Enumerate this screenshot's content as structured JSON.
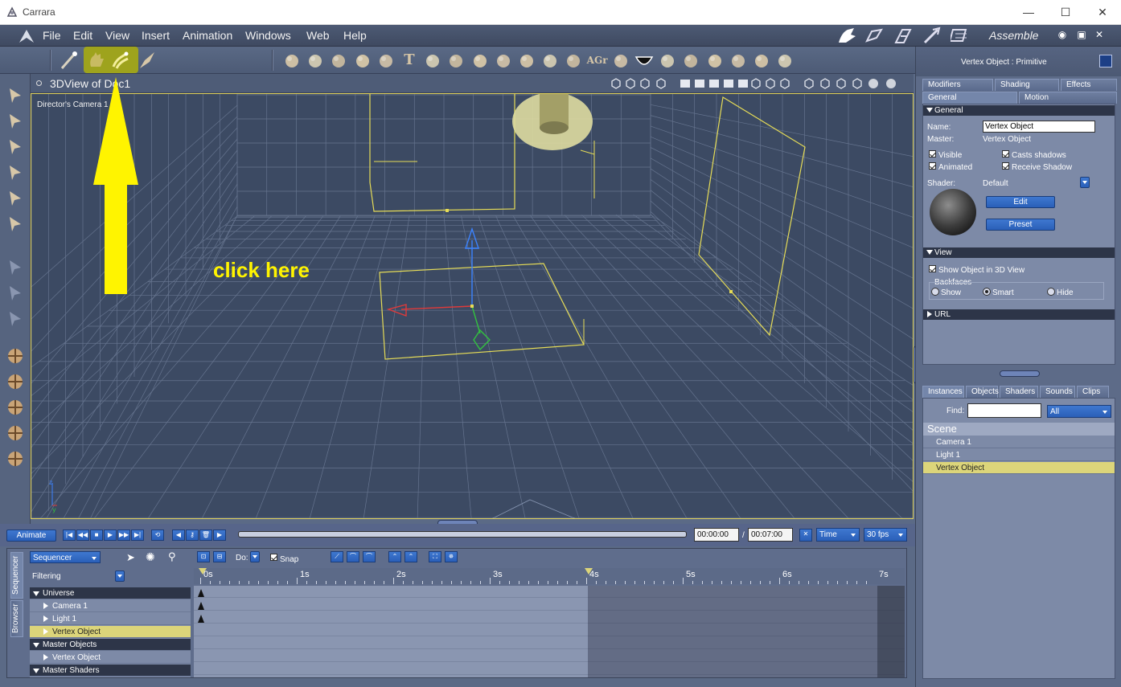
{
  "window": {
    "title": "Carrara",
    "minimize": "—",
    "maximize": "☐",
    "close": "✕"
  },
  "menu": [
    "File",
    "Edit",
    "View",
    "Insert",
    "Animation",
    "Windows",
    "Web",
    "Help"
  ],
  "room": {
    "label": "Assemble"
  },
  "viewport": {
    "title": "3DView of Doc1",
    "camera": "Director's Camera 1",
    "annotation": "click here"
  },
  "colors": {
    "annotation": "#fff400",
    "highlight": "#9ea31d",
    "selected_row": "#dcd57a",
    "grid": "#8997b3",
    "wire": "#e6dc57"
  },
  "right_panel": {
    "title": "Vertex Object : Primitive",
    "tabs_top": [
      "Modifiers",
      "Shading",
      "Effects"
    ],
    "tabs_sub": [
      "General",
      "Motion"
    ],
    "general": {
      "header": "General",
      "name_label": "Name:",
      "name_value": "Vertex Object",
      "master_label": "Master:",
      "master_value": "Vertex Object",
      "visible": "Visible",
      "casts_shadows": "Casts shadows",
      "animated": "Animated",
      "receive_shadow": "Receive Shadow",
      "shader_label": "Shader:",
      "shader_value": "Default",
      "edit": "Edit",
      "preset": "Preset"
    },
    "view": {
      "header": "View",
      "show_in_3d": "Show Object in 3D View",
      "backfaces": "Backfaces",
      "show": "Show",
      "smart": "Smart",
      "hide": "Hide"
    },
    "url": {
      "header": "URL"
    },
    "browser_tabs": [
      "Instances",
      "Objects",
      "Shaders",
      "Sounds",
      "Clips"
    ],
    "find_label": "Find:",
    "find_value": "",
    "filter_value": "All",
    "scene_header": "Scene",
    "scene_items": [
      "Camera 1",
      "Light 1",
      "Vertex Object"
    ]
  },
  "timeline": {
    "animate": "Animate",
    "current_time": "00:00:00",
    "slash": "/",
    "end_time": "00:07:00",
    "time_mode": "Time",
    "fps": "30 fps",
    "sequencer": "Sequencer",
    "do_label": "Do:",
    "snap": "Snap",
    "filtering": "Filtering",
    "side_tabs": [
      "Sequencer",
      "Browser"
    ],
    "ticks": [
      "0s",
      "1s",
      "2s",
      "3s",
      "4s",
      "5s",
      "6s",
      "7s"
    ],
    "tree": [
      {
        "label": "Universe",
        "kind": "group"
      },
      {
        "label": "Camera 1",
        "kind": "item"
      },
      {
        "label": "Light 1",
        "kind": "item"
      },
      {
        "label": "Vertex Object",
        "kind": "selected"
      },
      {
        "label": "Master Objects",
        "kind": "group"
      },
      {
        "label": "Vertex Object",
        "kind": "item"
      },
      {
        "label": "Master Shaders",
        "kind": "group"
      }
    ]
  }
}
